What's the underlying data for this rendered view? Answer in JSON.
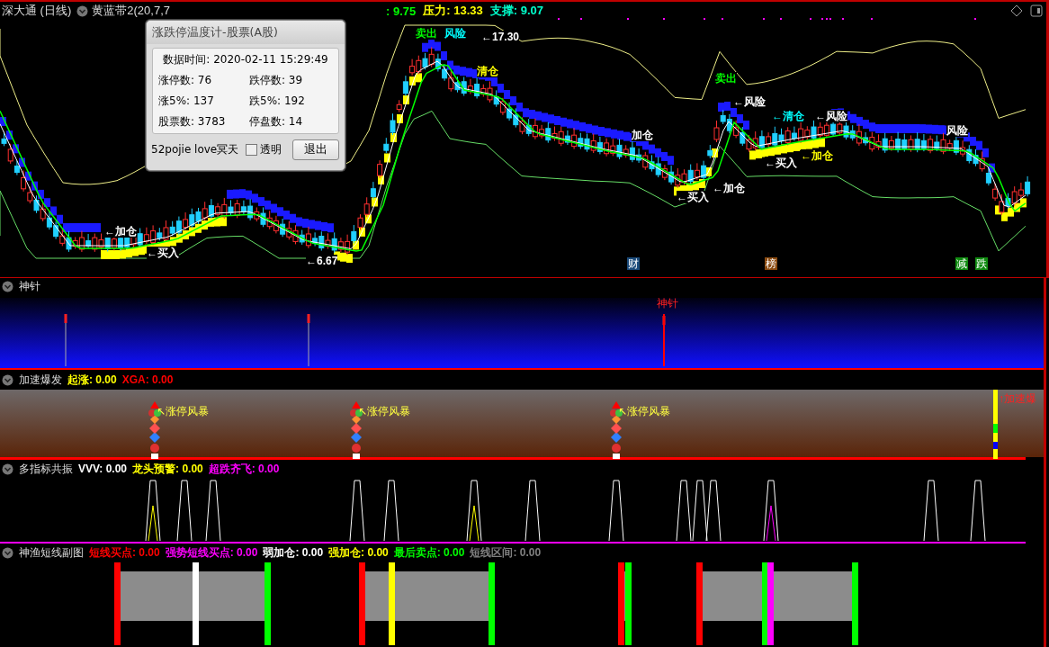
{
  "chart_header": {
    "symbol": "深大通 (日线)",
    "indicator": "黄蓝带2(20,7,7",
    "readings": [
      {
        "text": ": 9.75",
        "color": "#00ff00"
      },
      {
        "text": "压力: 13.33",
        "color": "#ffff00"
      },
      {
        "text": "支撑: 9.07",
        "color": "#00ffcc"
      }
    ]
  },
  "chart_annotations": [
    {
      "text": "←加仓",
      "color": "#ffffff"
    },
    {
      "text": "←买入",
      "color": "#ffffff"
    },
    {
      "text": "←6.67",
      "color": "#ffffff"
    },
    {
      "text": "卖出",
      "color": "#00ff00"
    },
    {
      "text": "风险",
      "color": "#00ffff"
    },
    {
      "text": "←17.30",
      "color": "#ffffff"
    },
    {
      "text": "清仓",
      "color": "#ffff00"
    },
    {
      "text": "加仓",
      "color": "#ffffff"
    },
    {
      "text": "←买入",
      "color": "#ffffff"
    },
    {
      "text": "←加仓",
      "color": "#ffffff"
    },
    {
      "text": "卖出",
      "color": "#00ff00"
    },
    {
      "text": "←风险",
      "color": "#ffffff"
    },
    {
      "text": "←清仓",
      "color": "#00ffff"
    },
    {
      "text": "←风险",
      "color": "#ffffff"
    },
    {
      "text": "←加仓",
      "color": "#ffff00"
    },
    {
      "text": "←买入",
      "color": "#ffffff"
    },
    {
      "text": "风险",
      "color": "#ffffff"
    }
  ],
  "event_badges": [
    {
      "text": "财",
      "color": "#1a4a7a"
    },
    {
      "text": "榜",
      "color": "#8a4a10"
    },
    {
      "text": "减",
      "color": "#108a10"
    },
    {
      "text": "跌",
      "color": "#108a10"
    }
  ],
  "dialog": {
    "title": "涨跌停温度计-股票(A股)",
    "data_time": "数据时间: 2020-02-11 15:29:49",
    "stats": [
      "涨停数: 76",
      "跌停数: 39",
      "涨5%: 137",
      "跌5%: 192",
      "股票数: 3783",
      "停盘数: 14"
    ],
    "footer": "52pojie love冥天",
    "transparent": {
      "label": "透明",
      "checked": false
    },
    "button": "退出"
  },
  "panels": [
    {
      "kind": "needle",
      "title": "神针",
      "label": "神针"
    },
    {
      "kind": "burst",
      "title": "加速爆发",
      "legend": [
        {
          "text": "起涨: 0.00",
          "color": "#ffff00"
        },
        {
          "text": "XGA: 0.00",
          "color": "#ff0000"
        }
      ],
      "labels": [
        "↖涨停风暴",
        "↖涨停风暴",
        "↖涨停风暴"
      ],
      "edge_label": "↑加速爆"
    },
    {
      "kind": "resonance",
      "title": "多指标共振",
      "legend": [
        {
          "text": "VVV: 0.00",
          "color": "#ffffff"
        },
        {
          "text": "龙头预警: 0.00",
          "color": "#ffff00"
        },
        {
          "text": "超跌齐飞: 0.00",
          "color": "#ff00ff"
        }
      ]
    },
    {
      "kind": "zones",
      "title": "神渔短线副图",
      "legend": [
        {
          "text": "短线买点: 0.00",
          "color": "#ff0000"
        },
        {
          "text": "强势短线买点: 0.00",
          "color": "#ff00ff"
        },
        {
          "text": "弱加仓: 0.00",
          "color": "#ffffff"
        },
        {
          "text": "强加仓: 0.00",
          "color": "#ffff00"
        },
        {
          "text": "最后卖点: 0.00",
          "color": "#00ff00"
        },
        {
          "text": "短线区间: 0.00",
          "color": "#808080"
        }
      ]
    }
  ]
}
